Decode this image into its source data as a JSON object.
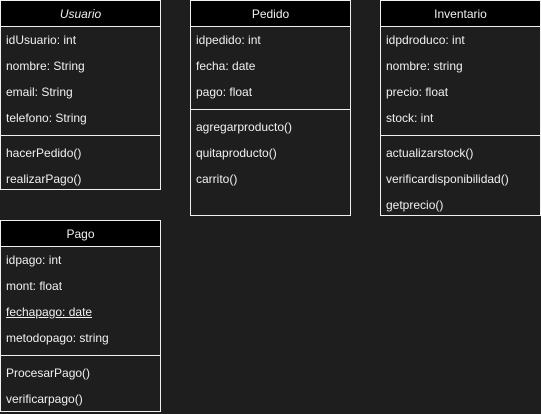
{
  "classes": [
    {
      "name": "Usuario",
      "italic": true,
      "attributes": [
        "idUsuario: int",
        "nombre: String",
        "email: String",
        "telefono: String"
      ],
      "methods": [
        "hacerPedido()",
        "realizarPago()"
      ]
    },
    {
      "name": "Pedido",
      "italic": false,
      "attributes": [
        "idpedido: int",
        "fecha: date",
        "pago: float"
      ],
      "methods": [
        "agregarproducto()",
        "quitaproducto()",
        "carrito()"
      ]
    },
    {
      "name": "Inventario",
      "italic": false,
      "attributes": [
        "idpdroduco: int",
        "nombre: string",
        "precio: float",
        "stock: int"
      ],
      "methods": [
        "actualizarstock()",
        "verificardisponibilidad()",
        "getprecio()"
      ]
    },
    {
      "name": "Pago",
      "italic": false,
      "attributes": [
        "idpago: int",
        "mont: float",
        "fechapago: date",
        "metodopago: string"
      ],
      "methods": [
        "ProcesarPago()",
        "verificarpago()"
      ],
      "underlined_attribute": "fechapago: date"
    }
  ],
  "colors": {
    "background": "#1e1e1e",
    "header": "#000000",
    "border": "#f0f0f0",
    "text": "#f0f0f0"
  }
}
